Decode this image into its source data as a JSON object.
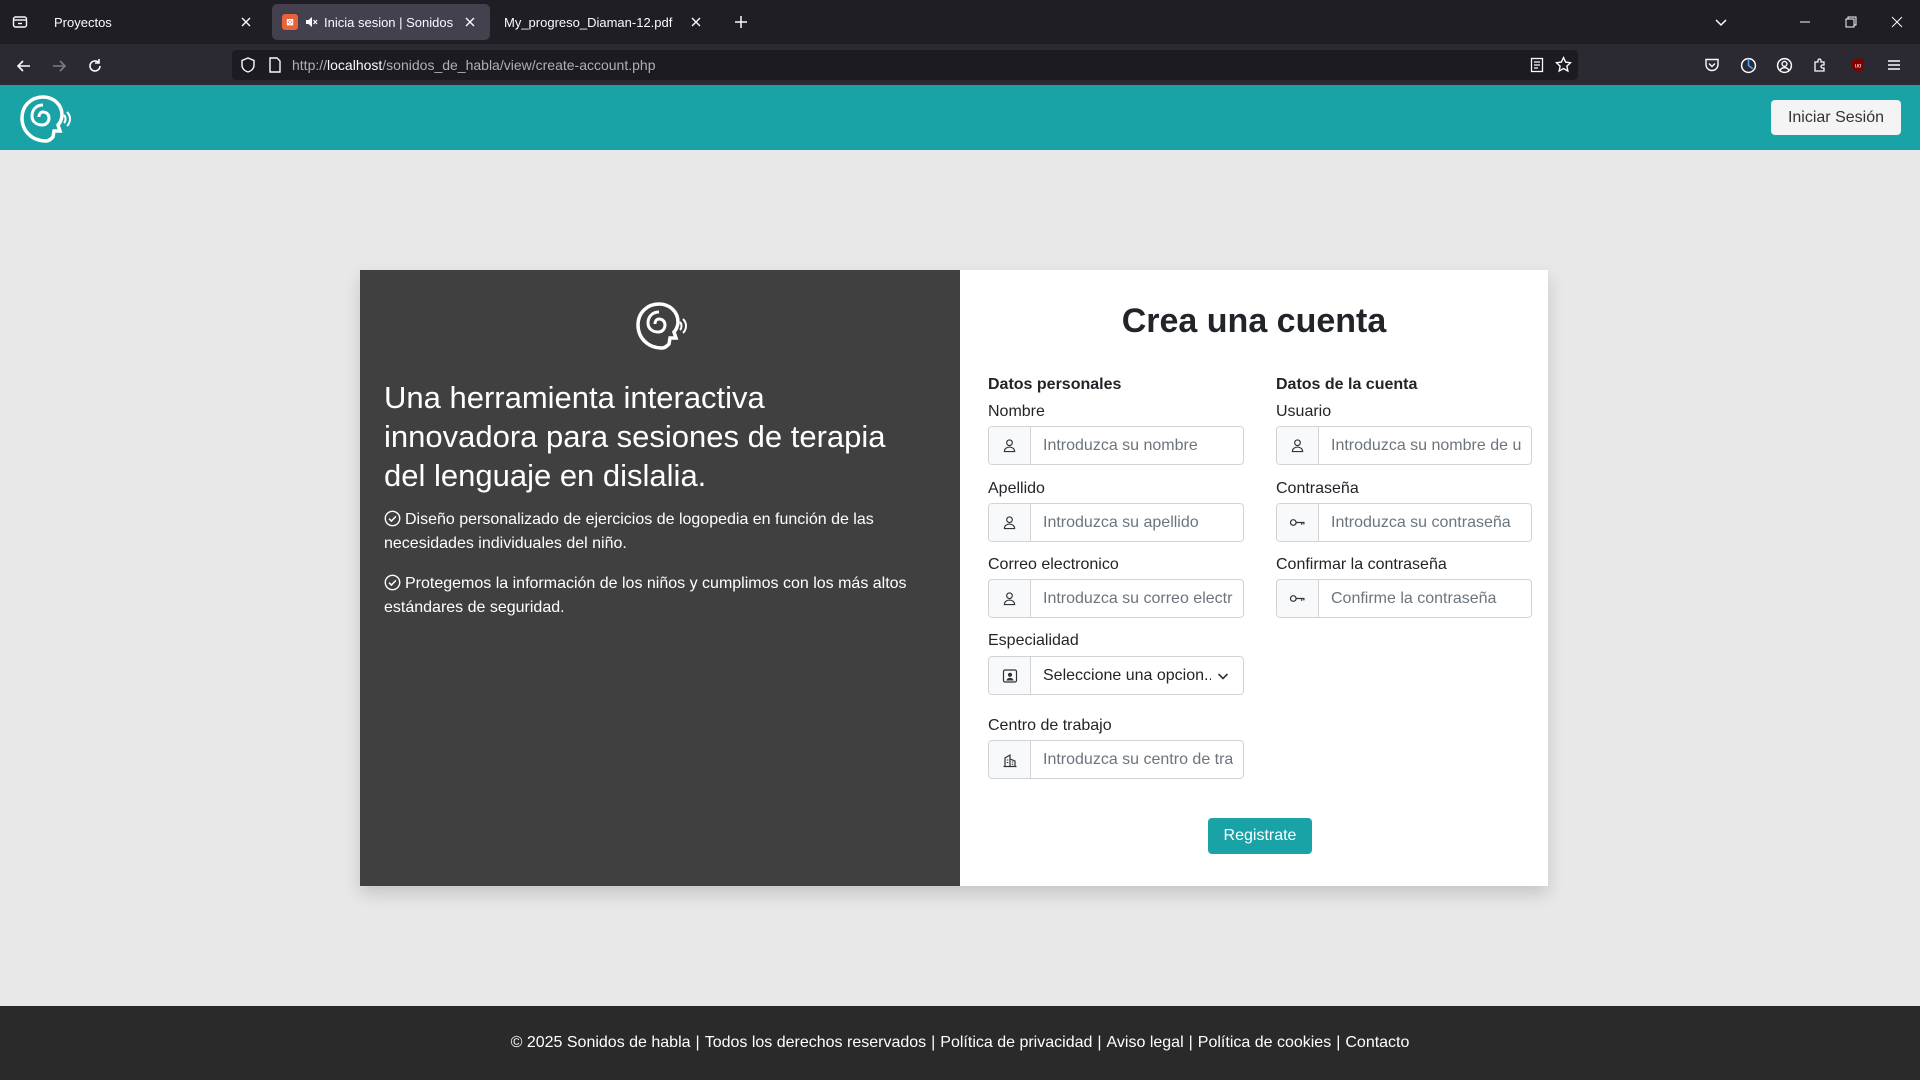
{
  "browser": {
    "tabs": [
      {
        "title": "Proyectos",
        "active": false
      },
      {
        "title": "Inicia sesion | Sonidos de habla",
        "active": true,
        "muted": true
      },
      {
        "title": "My_progreso_Diaman-12.pdf",
        "active": false
      }
    ],
    "url_prefix": "http://",
    "url_host": "localhost",
    "url_path": "/sonidos_de_habla/view/create-account.php"
  },
  "header": {
    "login_label": "Iniciar Sesión",
    "brand_color": "#1aa3a6"
  },
  "promo": {
    "headline": "Una herramienta interactiva innovadora para sesiones de terapia del lenguaje en dislalia.",
    "features": [
      "Diseño personalizado de ejercicios de logopedia en función de las necesidades individuales del niño.",
      "Protegemos la información de los niños y cumplimos con los más altos estándares de seguridad."
    ]
  },
  "form": {
    "title": "Crea una cuenta",
    "personal": {
      "section": "Datos personales",
      "nombre_label": "Nombre",
      "nombre_placeholder": "Introduzca su nombre",
      "apellido_label": "Apellido",
      "apellido_placeholder": "Introduzca su apellido",
      "correo_label": "Correo electronico",
      "correo_placeholder": "Introduzca su correo electronico",
      "especialidad_label": "Especialidad",
      "especialidad_value": "Seleccione una opcion...",
      "centro_label": "Centro de trabajo",
      "centro_placeholder": "Introduzca su centro de trabajo"
    },
    "account": {
      "section": "Datos de la cuenta",
      "usuario_label": "Usuario",
      "usuario_placeholder": "Introduzca su nombre de usuario",
      "password_label": "Contraseña",
      "password_placeholder": "Introduzca su contraseña",
      "confirm_label": "Confirmar la contraseña",
      "confirm_placeholder": "Confirme la contraseña"
    },
    "submit_label": "Registrate"
  },
  "footer": {
    "copyright": "© 2025 Sonidos de habla",
    "links": [
      "Todos los derechos reservados",
      "Política de privacidad",
      "Aviso legal",
      "Política de cookies",
      "Contacto"
    ]
  }
}
